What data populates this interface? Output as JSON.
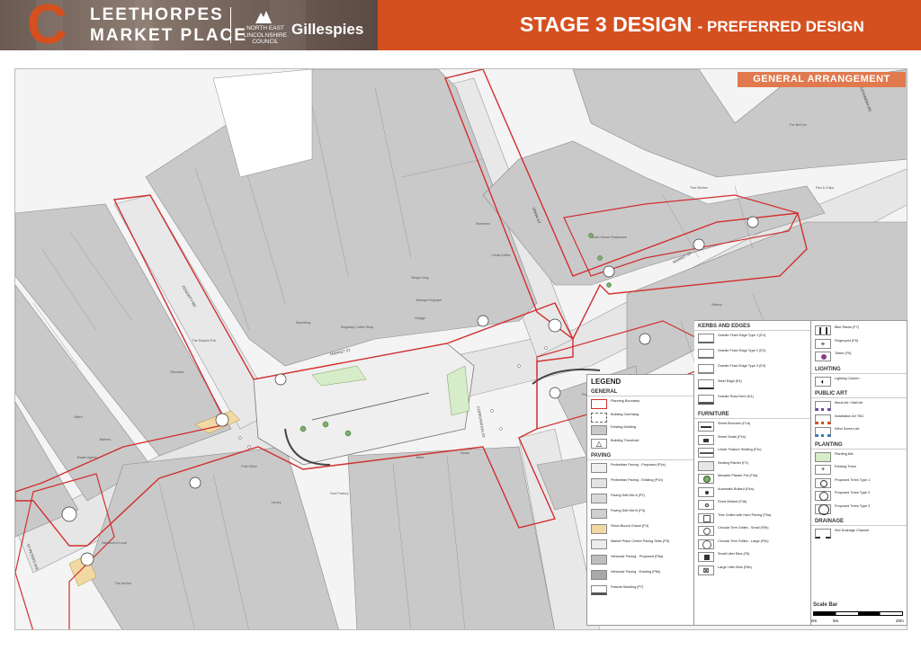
{
  "header": {
    "logo_letter": "C",
    "title_line1": "LEETHORPES",
    "title_line2": "MARKET PLACE",
    "council_name": "NORTH EAST LINCOLNSHIRE COUNCIL",
    "consultant": "Gillespies",
    "stage_title": "STAGE 3 DESIGN",
    "stage_subtitle": "- PREFERRED DESIGN",
    "accent_color": "#d5501f"
  },
  "banner": {
    "label": "GENERAL ARRANGEMENT"
  },
  "map": {
    "streets": [
      "MARKET ST",
      "MARKET ST",
      "ST PETERS AVE",
      "CORPORATION ST",
      "DOUGHTY RD",
      "ALEXANDRA RD",
      "UNION ST"
    ],
    "buildings": [
      "Burger King",
      "Morrisons",
      "Costa Coffee",
      "Superdrug",
      "Kingsway Coffee Shop",
      "Greggs",
      "Bodega Ferguson",
      "Tudor House Restaurant",
      "Thai Kitchen",
      "The Bell Inn",
      "Riverside",
      "Sainsbury's Local",
      "The Anchor",
      "Fish & Chips",
      "Bank",
      "Boots",
      "Post Office",
      "Library",
      "Card Factory",
      "Phone Shop",
      "Bakery",
      "Pharmacy",
      "Bistro",
      "Barbers",
      "The Dolphin Pub",
      "Estate Agents"
    ]
  },
  "legend": {
    "title": "LEGEND",
    "general": {
      "heading": "GENERAL",
      "items": [
        "Planning Boundary",
        "Building Overhang",
        "Existing Building",
        "Building Threshold"
      ]
    },
    "paving": {
      "heading": "PAVING",
      "items": [
        "Pedestrian Paving - Proposed (P1a)",
        "Pedestrian Paving - Existing (P1b)",
        "Paving Sett Mix A (P2)",
        "Paving Sett Mix B (P3)",
        "Resin Bound Gravel (P4)",
        "Market Place Centre Paving Setts (P5)",
        "Vehicular Paving - Proposed (P6a)",
        "Vehicular Paving - Existing (P6b)",
        "Feature Banding (P7)"
      ]
    },
    "kerbs": {
      "heading": "KERBS AND EDGES",
      "items": [
        "Granite Flush Edge Type 1 (E1)",
        "Granite Flush Edge Type 2 (E2)",
        "Granite Flush Edge Type 3 (E3)",
        "Steel Edge (E4)",
        "Granite Road Kerb (K1)"
      ]
    },
    "furniture": {
      "heading": "FURNITURE",
      "items": [
        "Street Benches (F1a)",
        "Street Seats (F1b)",
        "Linear Feature Seating (F1c)",
        "Seating Planter (F2)",
        "Movable Planter Pot (F3a)",
        "Automatic Bollard (F4a)",
        "Fixed Bollard (F4b)",
        "Tree Grilles with Hard Paving (F5a)",
        "Circular Tree Grilles - Small (F5b)",
        "Circular Tree Grilles - Large (F5c)",
        "Small Litter Bins (F6)",
        "Large Litter Bins (F6b)"
      ]
    },
    "misc": {
      "items": [
        "Bike Racks (F7)",
        "Fingerpost (F8)",
        "Totem (F9)"
      ]
    },
    "lighting": {
      "heading": "LIGHTING",
      "items": [
        "Lighting Column"
      ]
    },
    "public_art": {
      "heading": "PUBLIC ART",
      "items": [
        "Mural Art / Wall Art",
        "Installation Art TBC",
        "Wind Screen Art"
      ]
    },
    "planting": {
      "heading": "PLANTING",
      "items": [
        "Planting Mix",
        "Existing Trees",
        "Proposed Trees Type 1",
        "Proposed Trees Type 2",
        "Proposed Trees Type 3"
      ]
    },
    "drainage": {
      "heading": "DRAINAGE",
      "items": [
        "Slot Drainage Channel"
      ]
    },
    "scale": {
      "title": "Scale Bar",
      "labels": [
        "0m",
        "5m",
        "20m"
      ]
    }
  }
}
